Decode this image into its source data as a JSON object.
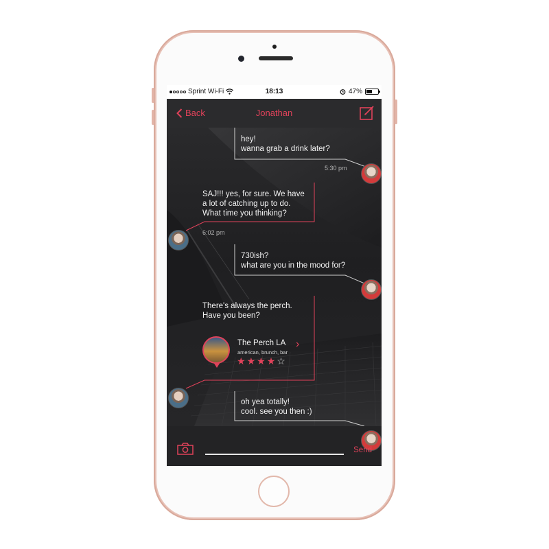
{
  "status": {
    "carrier": "Sprint Wi-Fi",
    "time": "18:13",
    "battery": "47%",
    "battery_level": 0.47,
    "icons": [
      "signal-dots-icon",
      "wifi-icon",
      "alarm-icon",
      "battery-icon"
    ]
  },
  "nav": {
    "back_label": "Back",
    "title": "Jonathan",
    "compose_icon": "compose-icon"
  },
  "messages": [
    {
      "from": "other",
      "lines": [
        "hey!",
        "wanna grab a drink later?"
      ],
      "time": "5:30 pm"
    },
    {
      "from": "me",
      "lines": [
        "SAJ!!! yes, for sure. We have",
        "a lot of catching up to do.",
        "What time you thinking?"
      ],
      "time": "6:02 pm"
    },
    {
      "from": "other",
      "lines": [
        "730ish?",
        "what are you in the mood for?"
      ]
    },
    {
      "from": "me",
      "lines": [
        "There's always the perch.",
        "Have you been?"
      ]
    },
    {
      "from": "other",
      "lines": [
        "oh yea totally!",
        "cool. see you then :)"
      ]
    }
  ],
  "place": {
    "name": "The Perch LA",
    "tags": "american, brunch, bar",
    "rating": 4,
    "rating_max": 5
  },
  "composer": {
    "send_label": "Send",
    "camera_icon": "camera-icon"
  },
  "colors": {
    "accent": "#e0425a",
    "background": "#2b2b2d",
    "text": "#f2f2f2",
    "phone": "#e7c1b6"
  }
}
